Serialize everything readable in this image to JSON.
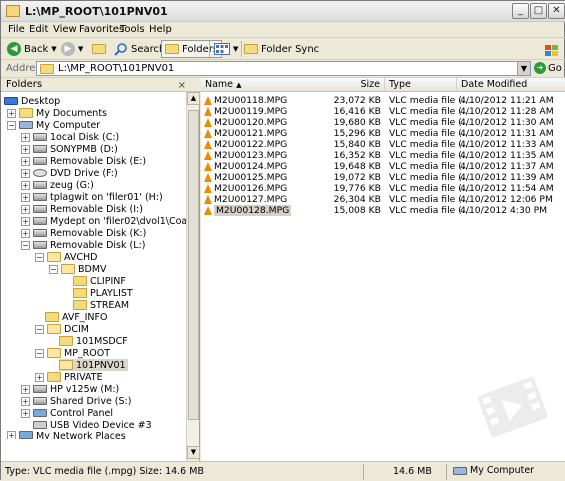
{
  "window": {
    "title": "L:\\MP_ROOT\\101PNV01"
  },
  "menu": [
    "File",
    "Edit",
    "View",
    "Favorites",
    "Tools",
    "Help"
  ],
  "toolbar": {
    "back": "Back",
    "search": "Search",
    "folders": "Folders",
    "folder_sync": "Folder Sync"
  },
  "address": {
    "label": "Address",
    "value": "L:\\MP_ROOT\\101PNV01",
    "go": "Go"
  },
  "folders_pane": {
    "title": "Folders",
    "close": "×"
  },
  "tree": [
    "Desktop",
    "My Documents",
    "My Computer",
    "1ocal Disk (C:)",
    "SONYPMB (D:)",
    "Removable Disk (E:)",
    "DVD Drive (F:)",
    "zeug (G:)",
    "tplagwit on 'filer01' (H:)",
    "Removable Disk (I:)",
    "Mydept on 'filer02\\dvol1\\Coas\\Lcs' (J:)",
    "Removable Disk (K:)",
    "Removable Disk (L:)",
    "AVCHD",
    "BDMV",
    "CLIPINF",
    "PLAYLIST",
    "STREAM",
    "AVF_INFO",
    "DCIM",
    "101MSDCF",
    "MP_ROOT",
    "101PNV01",
    "PRIVATE",
    "HP v125w (M:)",
    "Shared Drive (S:)",
    "Control Panel",
    "USB Video Device #3",
    "My Network Places"
  ],
  "columns": {
    "name": "Name",
    "size": "Size",
    "type": "Type",
    "modified": "Date Modified"
  },
  "files": [
    {
      "name": "M2U00118.MPG",
      "size": "23,072 KB",
      "type": "VLC media file (....",
      "modified": "4/10/2012 11:21 AM"
    },
    {
      "name": "M2U00119.MPG",
      "size": "16,416 KB",
      "type": "VLC media file (....",
      "modified": "4/10/2012 11:28 AM"
    },
    {
      "name": "M2U00120.MPG",
      "size": "19,680 KB",
      "type": "VLC media file (....",
      "modified": "4/10/2012 11:30 AM"
    },
    {
      "name": "M2U00121.MPG",
      "size": "15,296 KB",
      "type": "VLC media file (....",
      "modified": "4/10/2012 11:31 AM"
    },
    {
      "name": "M2U00122.MPG",
      "size": "15,840 KB",
      "type": "VLC media file (....",
      "modified": "4/10/2012 11:33 AM"
    },
    {
      "name": "M2U00123.MPG",
      "size": "16,352 KB",
      "type": "VLC media file (....",
      "modified": "4/10/2012 11:35 AM"
    },
    {
      "name": "M2U00124.MPG",
      "size": "19,648 KB",
      "type": "VLC media file (....",
      "modified": "4/10/2012 11:37 AM"
    },
    {
      "name": "M2U00125.MPG",
      "size": "19,072 KB",
      "type": "VLC media file (....",
      "modified": "4/10/2012 11:39 AM"
    },
    {
      "name": "M2U00126.MPG",
      "size": "19,776 KB",
      "type": "VLC media file (....",
      "modified": "4/10/2012 11:54 AM"
    },
    {
      "name": "M2U00127.MPG",
      "size": "26,304 KB",
      "type": "VLC media file (....",
      "modified": "4/10/2012 12:06 PM"
    },
    {
      "name": "M2U00128.MPG",
      "size": "15,008 KB",
      "type": "VLC media file (....",
      "modified": "4/10/2012 4:30 PM"
    }
  ],
  "status": {
    "info": "Type: VLC media file (.mpg) Size: 14.6 MB",
    "size": "14.6 MB",
    "location": "My Computer"
  }
}
